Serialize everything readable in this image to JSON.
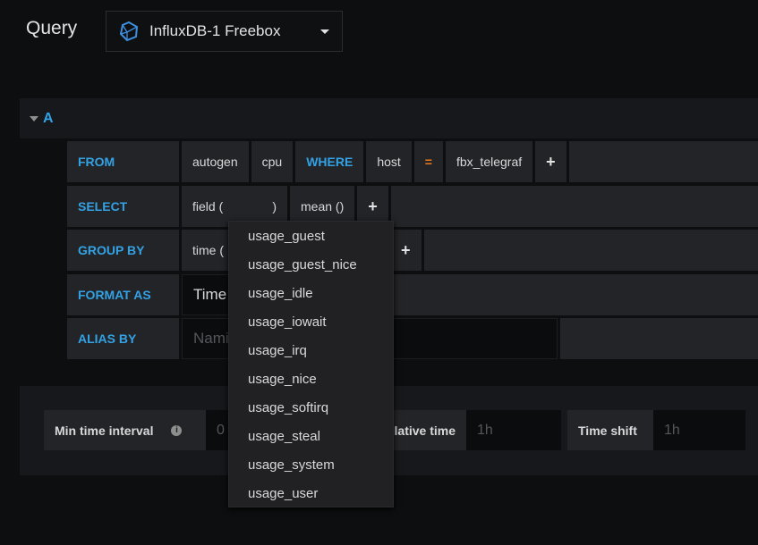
{
  "header": {
    "title": "Query",
    "datasource": "InfluxDB-1 Freebox"
  },
  "query": {
    "ref": "A",
    "from": {
      "label": "FROM",
      "policy": "autogen",
      "measurement": "cpu",
      "where_label": "WHERE",
      "tag_key": "host",
      "operator": "=",
      "tag_value": "fbx_telegraf",
      "add": "+"
    },
    "select": {
      "label": "SELECT",
      "field": "field (",
      "field_close": ")",
      "func": "mean ()",
      "add": "+"
    },
    "group_by": {
      "label": "GROUP BY",
      "time": "time (",
      "add": "+"
    },
    "format_as": {
      "label": "FORMAT AS",
      "value": "Time series"
    },
    "alias_by": {
      "label": "ALIAS BY",
      "placeholder": "Naming pattern"
    }
  },
  "options": {
    "min_interval_label": "Min time interval",
    "min_interval_placeholder": "0",
    "relative_time_label": "Relative time",
    "relative_time_placeholder": "1h",
    "time_shift_label": "Time shift",
    "time_shift_placeholder": "1h"
  },
  "dropdown": {
    "items": [
      "usage_guest",
      "usage_guest_nice",
      "usage_idle",
      "usage_iowait",
      "usage_irq",
      "usage_nice",
      "usage_softirq",
      "usage_steal",
      "usage_system",
      "usage_user"
    ]
  },
  "colors": {
    "accent": "#33a2e5",
    "operator": "#eb7b18"
  }
}
